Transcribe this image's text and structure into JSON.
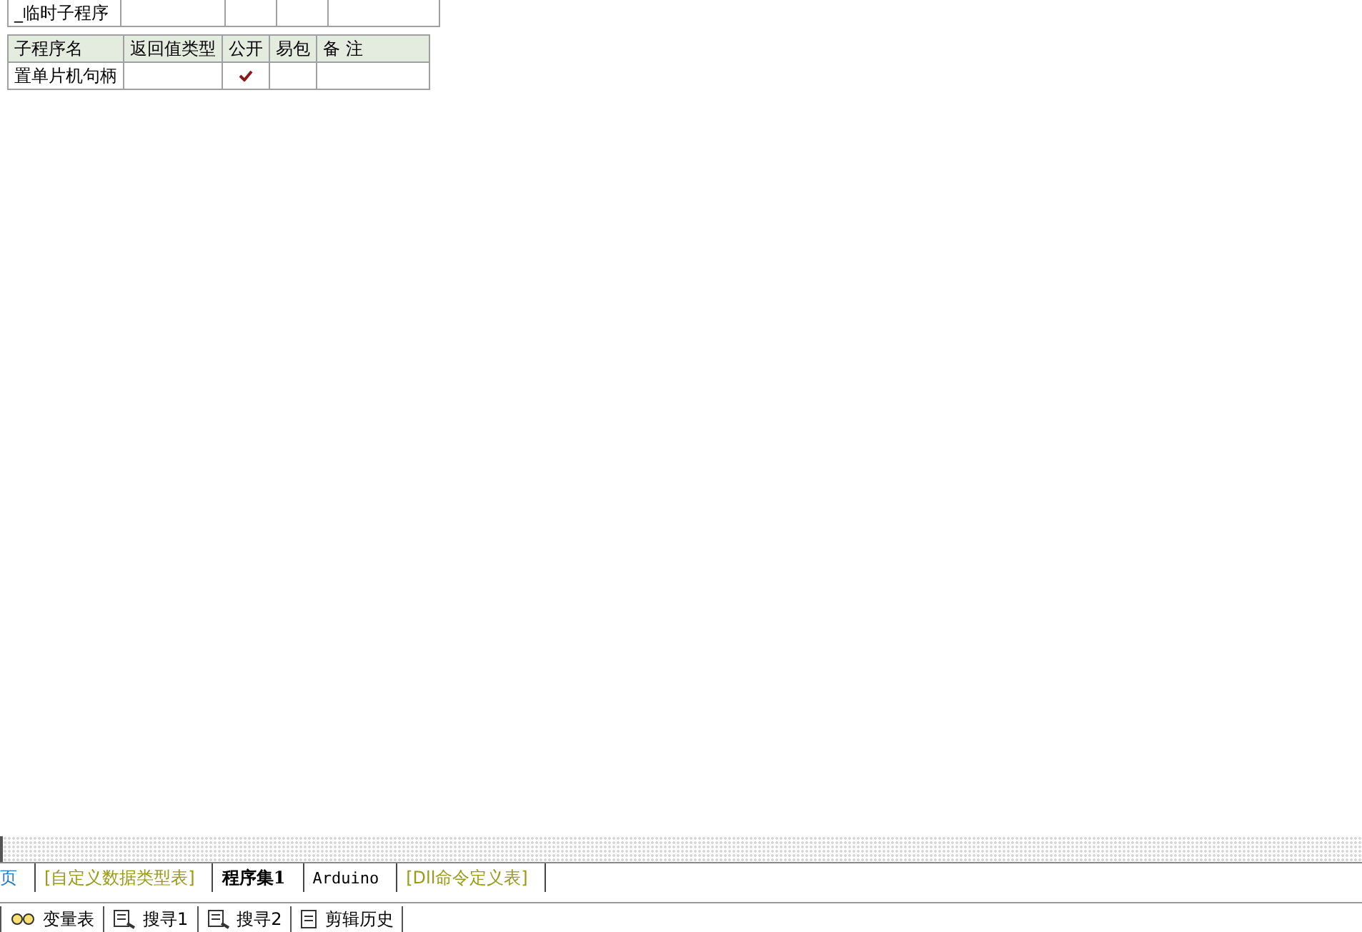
{
  "temp_table": {
    "rows": [
      {
        "name": "_临时子程序"
      }
    ]
  },
  "sub_table": {
    "columns": [
      "子程序名",
      "返回值类型",
      "公开",
      "易包",
      "备 注"
    ],
    "rows": [
      {
        "name": "置单片机句柄",
        "public": true,
        "easy_pkg": false
      }
    ]
  },
  "tabs": [
    {
      "label": "页",
      "kind": "page",
      "selected": false
    },
    {
      "label": "[自定义数据类型表]",
      "kind": "table",
      "selected": false
    },
    {
      "label": "程序集1",
      "kind": "class",
      "selected": true
    },
    {
      "label": "Arduino",
      "kind": "class",
      "selected": false
    },
    {
      "label": "[Dll命令定义表]",
      "kind": "table",
      "selected": false
    }
  ],
  "bottom_tabs": [
    {
      "label": "变量表",
      "kind": "vars"
    },
    {
      "label": "搜寻1",
      "kind": "search"
    },
    {
      "label": "搜寻2",
      "kind": "search"
    },
    {
      "label": "剪辑历史",
      "kind": "clip"
    }
  ]
}
